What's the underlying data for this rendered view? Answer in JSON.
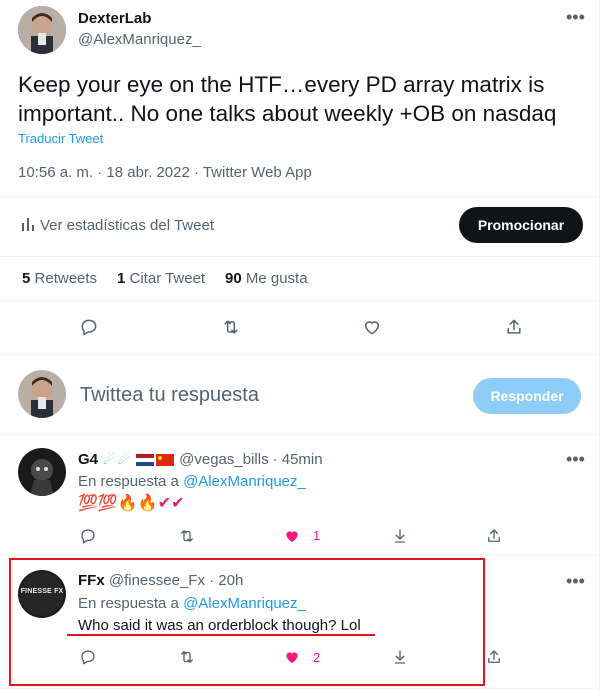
{
  "tweet": {
    "author_name": "DexterLab",
    "author_handle": "@AlexManriquez_",
    "text": "Keep your eye on the HTF…every PD array matrix is important.. No one talks about weekly +OB on nasdaq",
    "translate": "Traducir Tweet",
    "timestamp": "10:56 a. m. · 18 abr. 2022 · Twitter Web App",
    "analytics": "Ver estadísticas del Tweet",
    "promote": "Promocionar",
    "stats": {
      "retweets_count": "5",
      "retweets_label": "Retweets",
      "quotes_count": "1",
      "quotes_label": "Citar Tweet",
      "likes_count": "90",
      "likes_label": "Me gusta"
    }
  },
  "composer": {
    "placeholder": "Twittea tu respuesta",
    "reply_button": "Responder"
  },
  "replies": [
    {
      "name": "G4",
      "handle": "@vegas_bills",
      "time": "· 45min",
      "replying_prefix": "En respuesta a",
      "replying_to": "@AlexManriquez_",
      "text": "💯💯🔥🔥✔✔",
      "likes": "1"
    },
    {
      "name": "FFx",
      "handle": "@finessee_Fx",
      "time": "· 20h",
      "replying_prefix": "En respuesta a",
      "replying_to": "@AlexManriquez_",
      "text": "Who said it was an orderblock though? Lol",
      "likes": "2",
      "avatar_text": "FINESSE FX"
    }
  ],
  "colors": {
    "accent": "#1d9bf0",
    "like_active": "#f91880",
    "highlight_box": "#e0141c"
  }
}
